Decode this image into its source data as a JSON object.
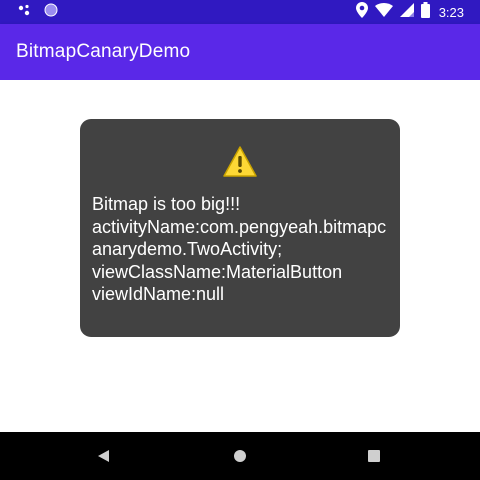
{
  "status_bar": {
    "time": "3:23",
    "icons": [
      "notification-dots-icon",
      "assistant-circle-icon",
      "location-icon",
      "wifi-icon",
      "cell-signal-icon",
      "battery-icon"
    ]
  },
  "app_bar": {
    "title": "BitmapCanaryDemo"
  },
  "toast": {
    "icon": "warning-icon",
    "message": "Bitmap is too big!!!\nactivityName:com.pengyeah.bitmapcanarydemo.TwoActivity;\nviewClassName:MaterialButton\nviewIdName:null"
  },
  "nav_bar": {
    "icons": [
      "back-icon",
      "home-icon",
      "recents-icon"
    ]
  },
  "colors": {
    "status_bar": "#3019c1",
    "app_bar": "#5a28e8",
    "toast_bg": "#424242",
    "warning_yellow": "#fdd835",
    "nav_bar": "#000000"
  }
}
